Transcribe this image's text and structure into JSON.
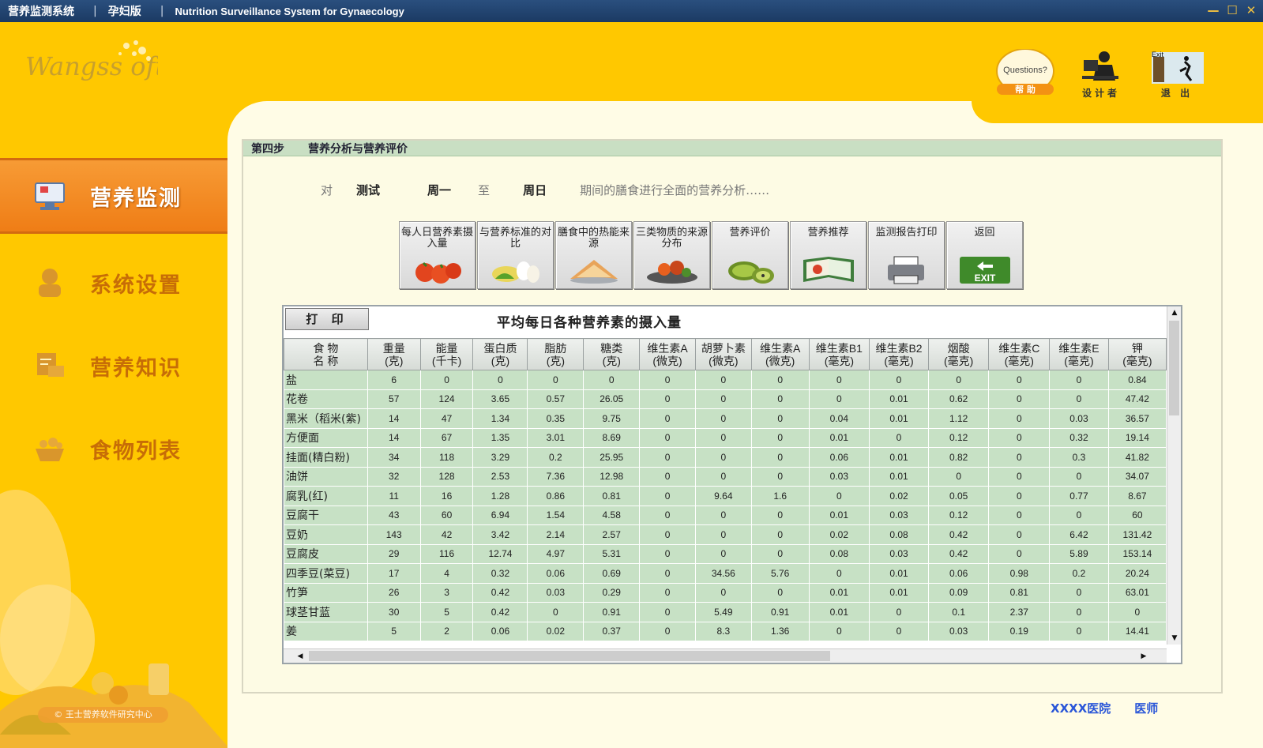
{
  "titlebar": {
    "app_name": "营养监测系统",
    "edition": "孕妇版",
    "english_title": "Nutrition Surveillance  System for Gynaecology",
    "controls": [
      "—",
      "☐",
      "✕"
    ]
  },
  "logo": {
    "text": "Wangss oft",
    "icon": "wangsoft-logo"
  },
  "top_icons": [
    {
      "name": "help",
      "caption": "帮 助",
      "sub": "Questions?",
      "icon": "help-question-icon"
    },
    {
      "name": "designer",
      "caption": "设计者",
      "icon": "designer-person-icon"
    },
    {
      "name": "exit",
      "caption": "退 出",
      "sub": "Exit",
      "icon": "exit-door-icon"
    }
  ],
  "sidebar": {
    "items": [
      {
        "label": "营养监测",
        "icon": "computer-monitor-icon",
        "active": true
      },
      {
        "label": "系统设置",
        "icon": "person-settings-icon",
        "active": false
      },
      {
        "label": "营养知识",
        "icon": "knowledge-book-icon",
        "active": false
      },
      {
        "label": "食物列表",
        "icon": "food-basket-icon",
        "active": false
      }
    ],
    "copyright": "© 王士营养软件研究中心"
  },
  "step": {
    "number": "第四步",
    "title": "营养分析与营养评价"
  },
  "range": {
    "prefix": "对",
    "subject": "测试",
    "from_day": "周一",
    "to_word": "至",
    "to_day": "周日",
    "suffix": "期间的膳食进行全面的营养分析……"
  },
  "function_buttons": [
    {
      "label": "每人日营养素摄入量",
      "icon": "tomatoes-icon"
    },
    {
      "label": "与营养标准的对比",
      "icon": "eggs-vegetables-icon"
    },
    {
      "label": "膳食中的热能来源",
      "icon": "bread-icon"
    },
    {
      "label": "三类物质的来源分布",
      "icon": "food-platter-icon"
    },
    {
      "label": "营养评价",
      "icon": "kiwi-icon"
    },
    {
      "label": "营养推荐",
      "icon": "open-book-icon"
    },
    {
      "label": "监测报告打印",
      "icon": "printer-icon"
    },
    {
      "label": "返回",
      "icon": "exit-sign-icon",
      "icon_text": "EXIT"
    }
  ],
  "grid": {
    "print_label": "打 印",
    "title": "平均每日各种营养素的摄入量",
    "columns": [
      "食  物\n名  称",
      "重量\n(克)",
      "能量\n(千卡)",
      "蛋白质\n(克)",
      "脂肪\n(克)",
      "糖类\n(克)",
      "维生素A\n(微克)",
      "胡萝卜素\n(微克)",
      "维生素A\n(微克)",
      "维生素B1\n(毫克)",
      "维生素B2\n(毫克)",
      "烟酸\n(毫克)",
      "维生素C\n(毫克)",
      "维生素E\n(毫克)",
      "钾\n(毫克)"
    ],
    "rows": [
      [
        "盐",
        "6",
        "0",
        "0",
        "0",
        "0",
        "0",
        "0",
        "0",
        "0",
        "0",
        "0",
        "0",
        "0",
        "0.84"
      ],
      [
        "花卷",
        "57",
        "124",
        "3.65",
        "0.57",
        "26.05",
        "0",
        "0",
        "0",
        "0",
        "0.01",
        "0.62",
        "0",
        "0",
        "47.42"
      ],
      [
        "黑米（稻米(紫)",
        "14",
        "47",
        "1.34",
        "0.35",
        "9.75",
        "0",
        "0",
        "0",
        "0.04",
        "0.01",
        "1.12",
        "0",
        "0.03",
        "36.57"
      ],
      [
        "方便面",
        "14",
        "67",
        "1.35",
        "3.01",
        "8.69",
        "0",
        "0",
        "0",
        "0.01",
        "0",
        "0.12",
        "0",
        "0.32",
        "19.14"
      ],
      [
        "挂面(精白粉)",
        "34",
        "118",
        "3.29",
        "0.2",
        "25.95",
        "0",
        "0",
        "0",
        "0.06",
        "0.01",
        "0.82",
        "0",
        "0.3",
        "41.82"
      ],
      [
        "油饼",
        "32",
        "128",
        "2.53",
        "7.36",
        "12.98",
        "0",
        "0",
        "0",
        "0.03",
        "0.01",
        "0",
        "0",
        "0",
        "34.07"
      ],
      [
        "腐乳(红)",
        "11",
        "16",
        "1.28",
        "0.86",
        "0.81",
        "0",
        "9.64",
        "1.6",
        "0",
        "0.02",
        "0.05",
        "0",
        "0.77",
        "8.67"
      ],
      [
        "豆腐干",
        "43",
        "60",
        "6.94",
        "1.54",
        "4.58",
        "0",
        "0",
        "0",
        "0.01",
        "0.03",
        "0.12",
        "0",
        "0",
        "60"
      ],
      [
        "豆奶",
        "143",
        "42",
        "3.42",
        "2.14",
        "2.57",
        "0",
        "0",
        "0",
        "0.02",
        "0.08",
        "0.42",
        "0",
        "6.42",
        "131.42"
      ],
      [
        "豆腐皮",
        "29",
        "116",
        "12.74",
        "4.97",
        "5.31",
        "0",
        "0",
        "0",
        "0.08",
        "0.03",
        "0.42",
        "0",
        "5.89",
        "153.14"
      ],
      [
        "四季豆(菜豆)",
        "17",
        "4",
        "0.32",
        "0.06",
        "0.69",
        "0",
        "34.56",
        "5.76",
        "0",
        "0.01",
        "0.06",
        "0.98",
        "0.2",
        "20.24"
      ],
      [
        "竹笋",
        "26",
        "3",
        "0.42",
        "0.03",
        "0.29",
        "0",
        "0",
        "0",
        "0.01",
        "0.01",
        "0.09",
        "0.81",
        "0",
        "63.01"
      ],
      [
        "球茎甘蓝",
        "30",
        "5",
        "0.42",
        "0",
        "0.91",
        "0",
        "5.49",
        "0.91",
        "0.01",
        "0",
        "0.1",
        "2.37",
        "0",
        "0"
      ],
      [
        "姜",
        "5",
        "2",
        "0.06",
        "0.02",
        "0.37",
        "0",
        "8.3",
        "1.36",
        "0",
        "0",
        "0.03",
        "0.19",
        "0",
        "14.41"
      ]
    ]
  },
  "footer": {
    "hospital": "XXXX医院",
    "doctor": "医师"
  },
  "colors": {
    "background": "#FFC800",
    "active_nav": "#EF7D16",
    "row_green": "#C7E1C5",
    "step_bar": "#C9DFC3"
  }
}
